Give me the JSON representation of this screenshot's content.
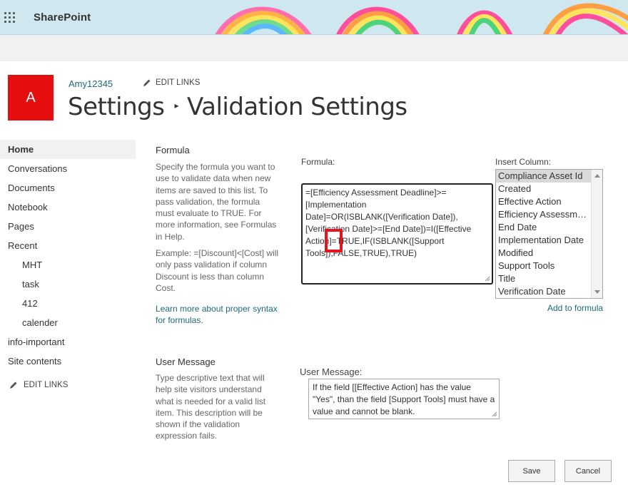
{
  "suite": {
    "brand": "SharePoint"
  },
  "site": {
    "logo_letter": "A",
    "name": "Amy12345",
    "edit_links": "EDIT LINKS",
    "breadcrumb_parent": "Settings",
    "breadcrumb_current": "Validation Settings"
  },
  "nav": {
    "items": [
      {
        "label": "Home",
        "active": true
      },
      {
        "label": "Conversations"
      },
      {
        "label": "Documents"
      },
      {
        "label": "Notebook"
      },
      {
        "label": "Pages"
      },
      {
        "label": "Recent"
      },
      {
        "label": "MHT",
        "sub": true
      },
      {
        "label": "task",
        "sub": true
      },
      {
        "label": "412",
        "sub": true
      },
      {
        "label": "calender",
        "sub": true
      },
      {
        "label": "info-important"
      },
      {
        "label": "Site contents"
      }
    ],
    "edit_links": "EDIT LINKS"
  },
  "formula_section": {
    "heading": "Formula",
    "description": "Specify the formula you want to use to validate data when new items are saved to this list. To pass validation, the formula must evaluate to TRUE. For more information, see Formulas in Help.",
    "example": "Example: =[Discount]<[Cost] will only pass validation if column Discount is less than column Cost.",
    "learn_more": "Learn more about proper syntax for formulas.",
    "field_label": "Formula:",
    "formula_value": "=[Efficiency Assessment Deadline]>=[Implementation Date]=OR(ISBLANK([Verification Date]),[Verification Date]>=[End Date])=I([Effective Action]=TRUE,IF(ISBLANK([Support Tools]),FALSE,TRUE),TRUE)"
  },
  "insert_column": {
    "label": "Insert Column:",
    "options": [
      {
        "label": "Compliance Asset Id",
        "selected": true
      },
      {
        "label": "Created"
      },
      {
        "label": "Effective Action"
      },
      {
        "label": "Efficiency Assessment Deadline"
      },
      {
        "label": "End Date"
      },
      {
        "label": "Implementation Date"
      },
      {
        "label": "Modified"
      },
      {
        "label": "Support Tools"
      },
      {
        "label": "Title"
      },
      {
        "label": "Verification Date"
      }
    ],
    "add_link": "Add to formula"
  },
  "user_message_section": {
    "heading": "User Message",
    "description": "Type descriptive text that will help site visitors understand what is needed for a valid list item. This description will be shown if the validation expression fails.",
    "field_label": "User Message:",
    "value": "If the field [[Effective Action] has the value \"Yes\", than the field [Support Tools] must have a value and cannot be blank."
  },
  "buttons": {
    "save": "Save",
    "cancel": "Cancel"
  },
  "colors": {
    "logo_bg": "#e60e0e",
    "link": "#1e6a76",
    "highlight_box": "#e2161c"
  }
}
